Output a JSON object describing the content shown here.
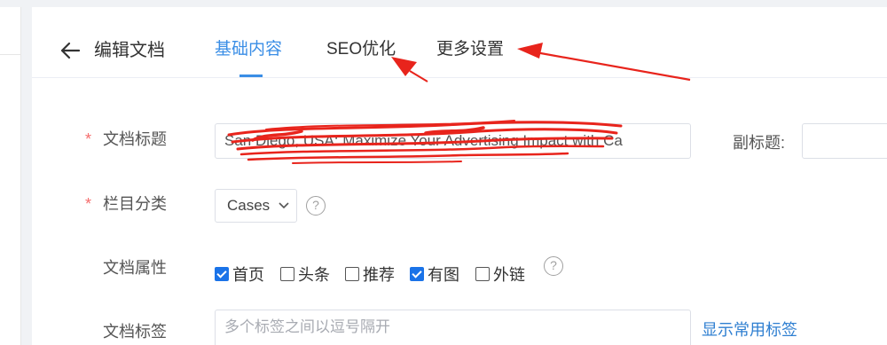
{
  "header": {
    "back_icon": "arrow-left-icon",
    "title": "编辑文档",
    "tabs": [
      {
        "label": "基础内容",
        "active": true
      },
      {
        "label": "SEO优化",
        "active": false
      },
      {
        "label": "更多设置",
        "active": false
      }
    ]
  },
  "form": {
    "title_field": {
      "required_mark": "*",
      "label": "文档标题",
      "value": "San Diego, USA: Maximize Your Advertising Impact with Ca"
    },
    "subtitle_field": {
      "label": "副标题:"
    },
    "category_field": {
      "required_mark": "*",
      "label": "栏目分类",
      "selected": "Cases",
      "help_icon": "question-circle-icon"
    },
    "attributes_field": {
      "label": "文档属性",
      "options": [
        {
          "label": "首页",
          "checked": true
        },
        {
          "label": "头条",
          "checked": false
        },
        {
          "label": "推荐",
          "checked": false
        },
        {
          "label": "有图",
          "checked": true
        },
        {
          "label": "外链",
          "checked": false
        }
      ],
      "help_icon": "question-circle-icon"
    },
    "tags_field": {
      "label": "文档标签",
      "placeholder": "多个标签之间以逗号隔开",
      "link": "显示常用标签"
    }
  },
  "colors": {
    "accent": "#3a8ee6",
    "required": "#f56c6c",
    "annotation": "#e8241c"
  }
}
